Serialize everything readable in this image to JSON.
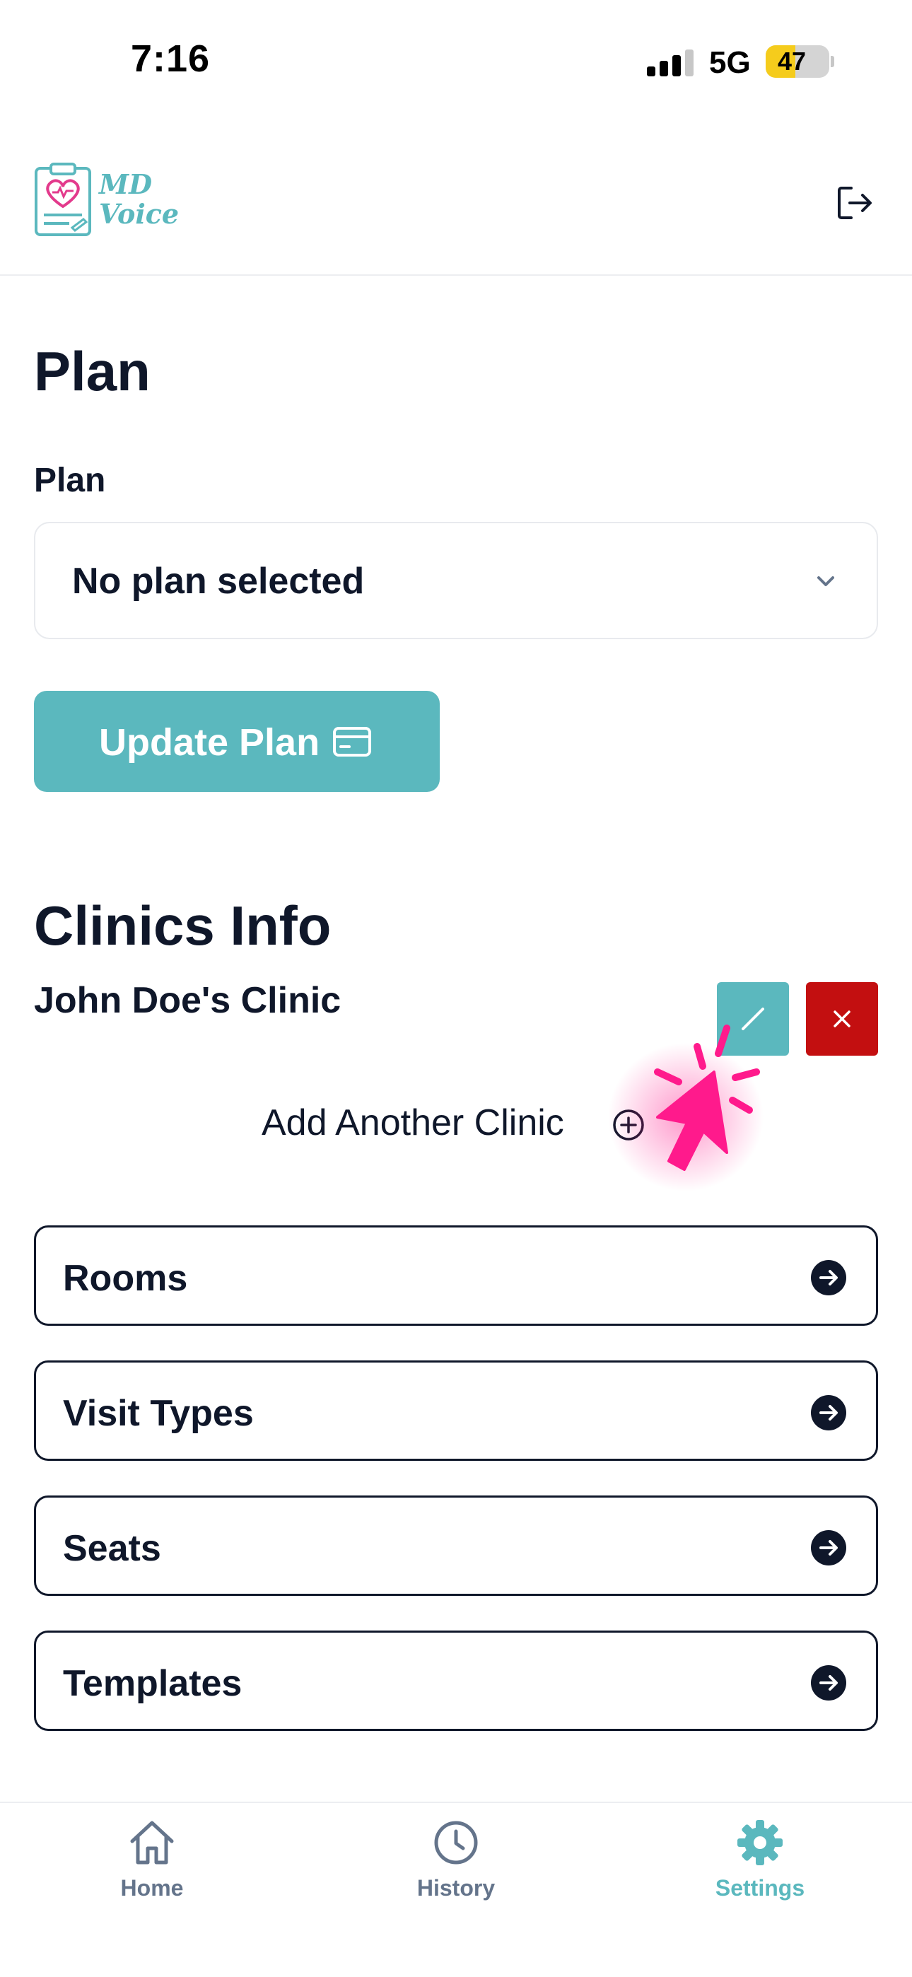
{
  "status_bar": {
    "time": "7:16",
    "network": "5G",
    "battery": "47",
    "battery_level_percent": 47
  },
  "header": {
    "logo_text_line1": "MD",
    "logo_text_line2": "Voice",
    "logout_icon": "logout-icon"
  },
  "plan_section": {
    "title": "Plan",
    "field_label": "Plan",
    "select_value": "No plan selected",
    "update_button": "Update Plan"
  },
  "clinics_section": {
    "title": "Clinics Info",
    "clinic_name": "John Doe's Clinic",
    "add_clinic_label": "Add Another Clinic"
  },
  "menu_items": [
    {
      "label": "Rooms"
    },
    {
      "label": "Visit Types"
    },
    {
      "label": "Seats"
    },
    {
      "label": "Templates"
    }
  ],
  "tab_bar": {
    "tabs": [
      {
        "label": "Home",
        "icon": "home-icon",
        "active": false
      },
      {
        "label": "History",
        "icon": "clock-icon",
        "active": false
      },
      {
        "label": "Settings",
        "icon": "gear-icon",
        "active": true
      }
    ]
  },
  "colors": {
    "accent": "#5bb8be",
    "danger": "#c30f10",
    "text": "#0f172a",
    "muted": "#64748b",
    "cursor": "#ff1a8c",
    "battery_fill": "#f5cc1c"
  }
}
